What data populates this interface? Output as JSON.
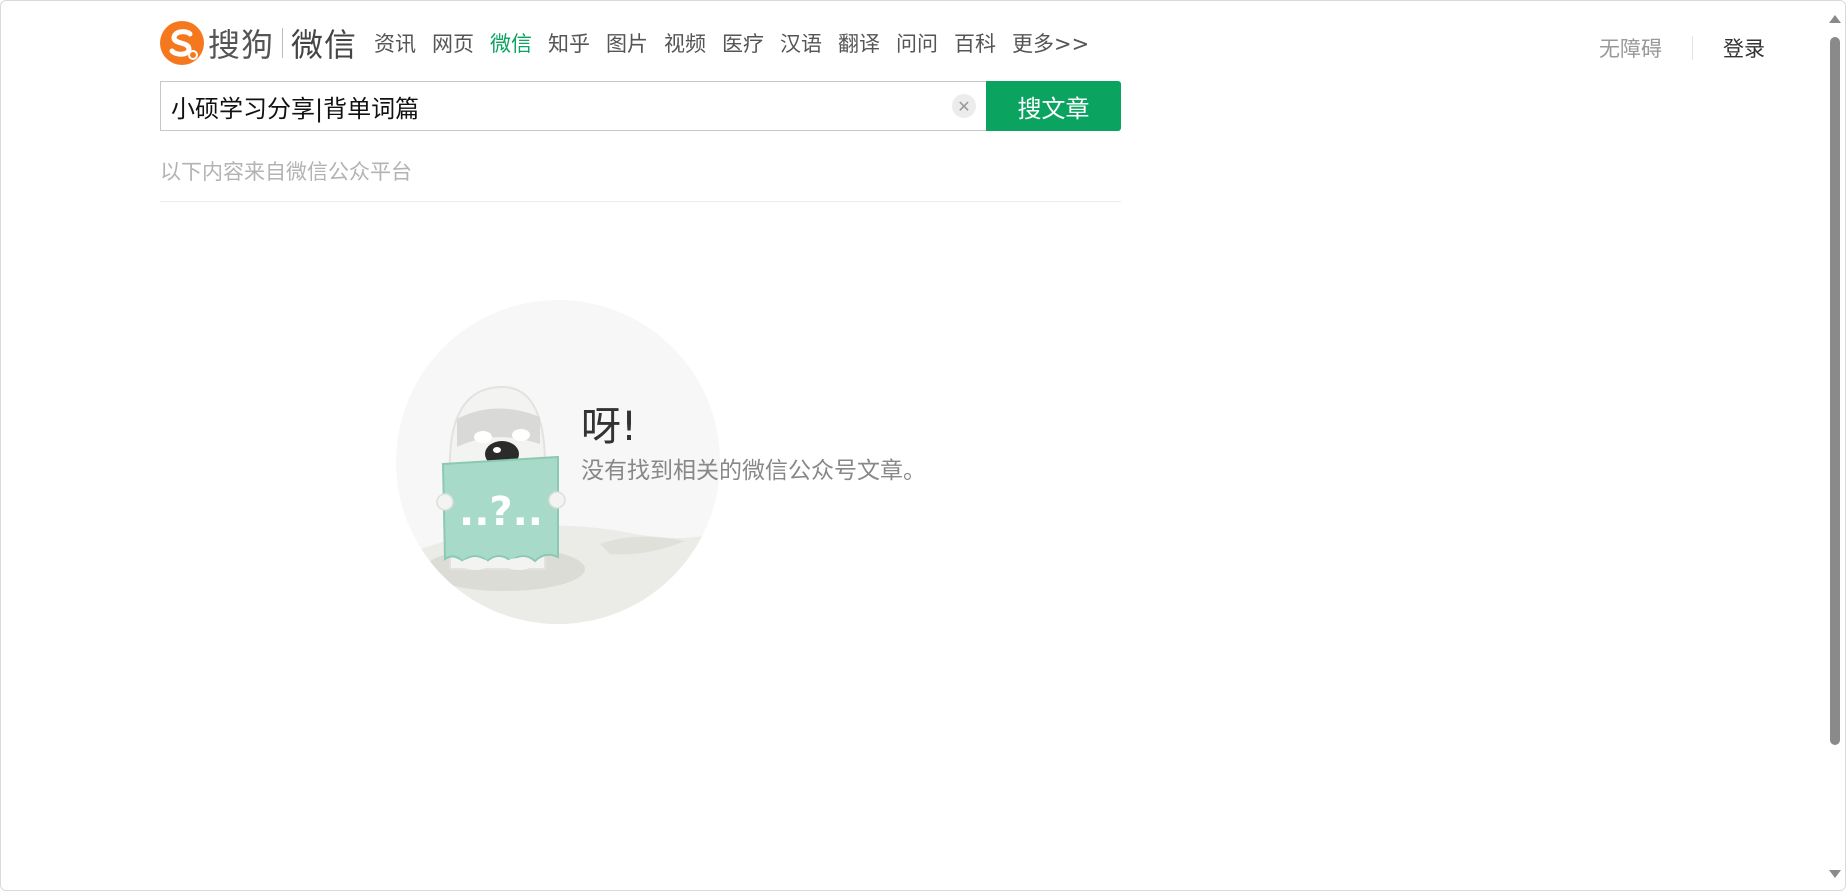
{
  "logo": {
    "brand": "搜狗",
    "product": "微信"
  },
  "nav": {
    "items": [
      {
        "label": "资讯",
        "active": false
      },
      {
        "label": "网页",
        "active": false
      },
      {
        "label": "微信",
        "active": true
      },
      {
        "label": "知乎",
        "active": false
      },
      {
        "label": "图片",
        "active": false
      },
      {
        "label": "视频",
        "active": false
      },
      {
        "label": "医疗",
        "active": false
      },
      {
        "label": "汉语",
        "active": false
      },
      {
        "label": "翻译",
        "active": false
      },
      {
        "label": "问问",
        "active": false
      },
      {
        "label": "百科",
        "active": false
      },
      {
        "label": "更多>>",
        "active": false
      }
    ]
  },
  "top_right": {
    "accessibility": "无障碍",
    "login": "登录"
  },
  "search": {
    "value": "小硕学习分享|背单词篇",
    "clear_icon": "✕",
    "button_label": "搜文章"
  },
  "source_note": "以下内容来自微信公众平台",
  "empty_state": {
    "title": "呀!",
    "message": "没有找到相关的微信公众号文章。",
    "sign_text": "..?.."
  },
  "colors": {
    "accent": "#0ba360",
    "logo_orange": "#f5781e"
  }
}
